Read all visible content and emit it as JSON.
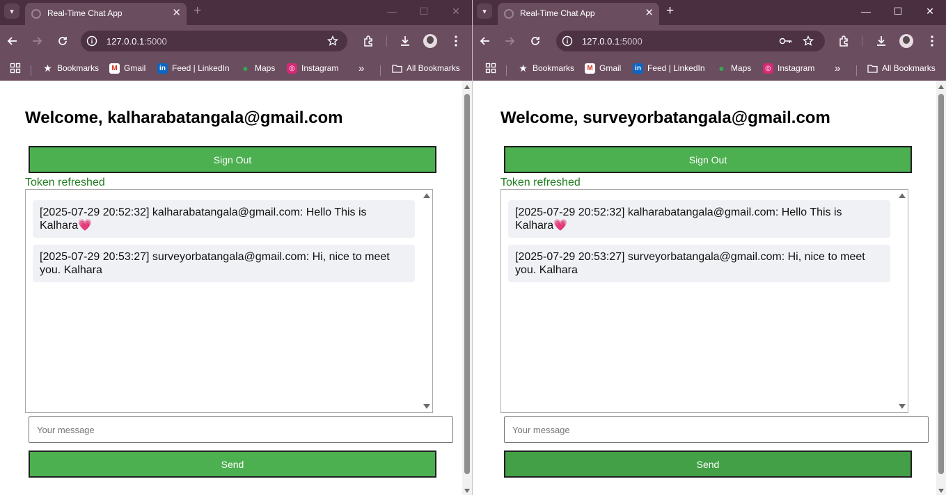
{
  "colors": {
    "tabstrip": "#4a2f40",
    "toolbar": "#6b4d60",
    "button_green": "#4caf50",
    "status_green": "#1e7d1e",
    "message_bg": "#f0f1f5"
  },
  "windows": [
    {
      "tab": {
        "title": "Real-Time Chat App"
      },
      "omnibox": {
        "host": "127.0.0.1",
        "port": ":5000"
      },
      "bookmarks": [
        "Bookmarks",
        "Gmail",
        "Feed | LinkedIn",
        "Maps",
        "Instagram",
        "All Bookmarks"
      ],
      "page": {
        "welcome": "Welcome, kalharabatangala@gmail.com",
        "sign_out_label": "Sign Out",
        "status": "Token refreshed",
        "messages": [
          {
            "text": "[2025-07-29 20:52:32] kalharabatangala@gmail.com: Hello This is Kalhara",
            "emoji": "💗"
          },
          {
            "text": "[2025-07-29 20:53:27] surveyorbatangala@gmail.com: Hi, nice to meet you. Kalhara",
            "emoji": ""
          }
        ],
        "input_placeholder": "Your message",
        "send_label": "Send"
      }
    },
    {
      "tab": {
        "title": "Real-Time Chat App"
      },
      "omnibox": {
        "host": "127.0.0.1",
        "port": ":5000"
      },
      "bookmarks": [
        "Bookmarks",
        "Gmail",
        "Feed | LinkedIn",
        "Maps",
        "Instagram",
        "All Bookmarks"
      ],
      "page": {
        "welcome": "Welcome, surveyorbatangala@gmail.com",
        "sign_out_label": "Sign Out",
        "status": "Token refreshed",
        "messages": [
          {
            "text": "[2025-07-29 20:52:32] kalharabatangala@gmail.com: Hello This is Kalhara",
            "emoji": "💗"
          },
          {
            "text": "[2025-07-29 20:53:27] surveyorbatangala@gmail.com: Hi, nice to meet you. Kalhara",
            "emoji": ""
          }
        ],
        "input_placeholder": "Your message",
        "send_label": "Send"
      }
    }
  ]
}
